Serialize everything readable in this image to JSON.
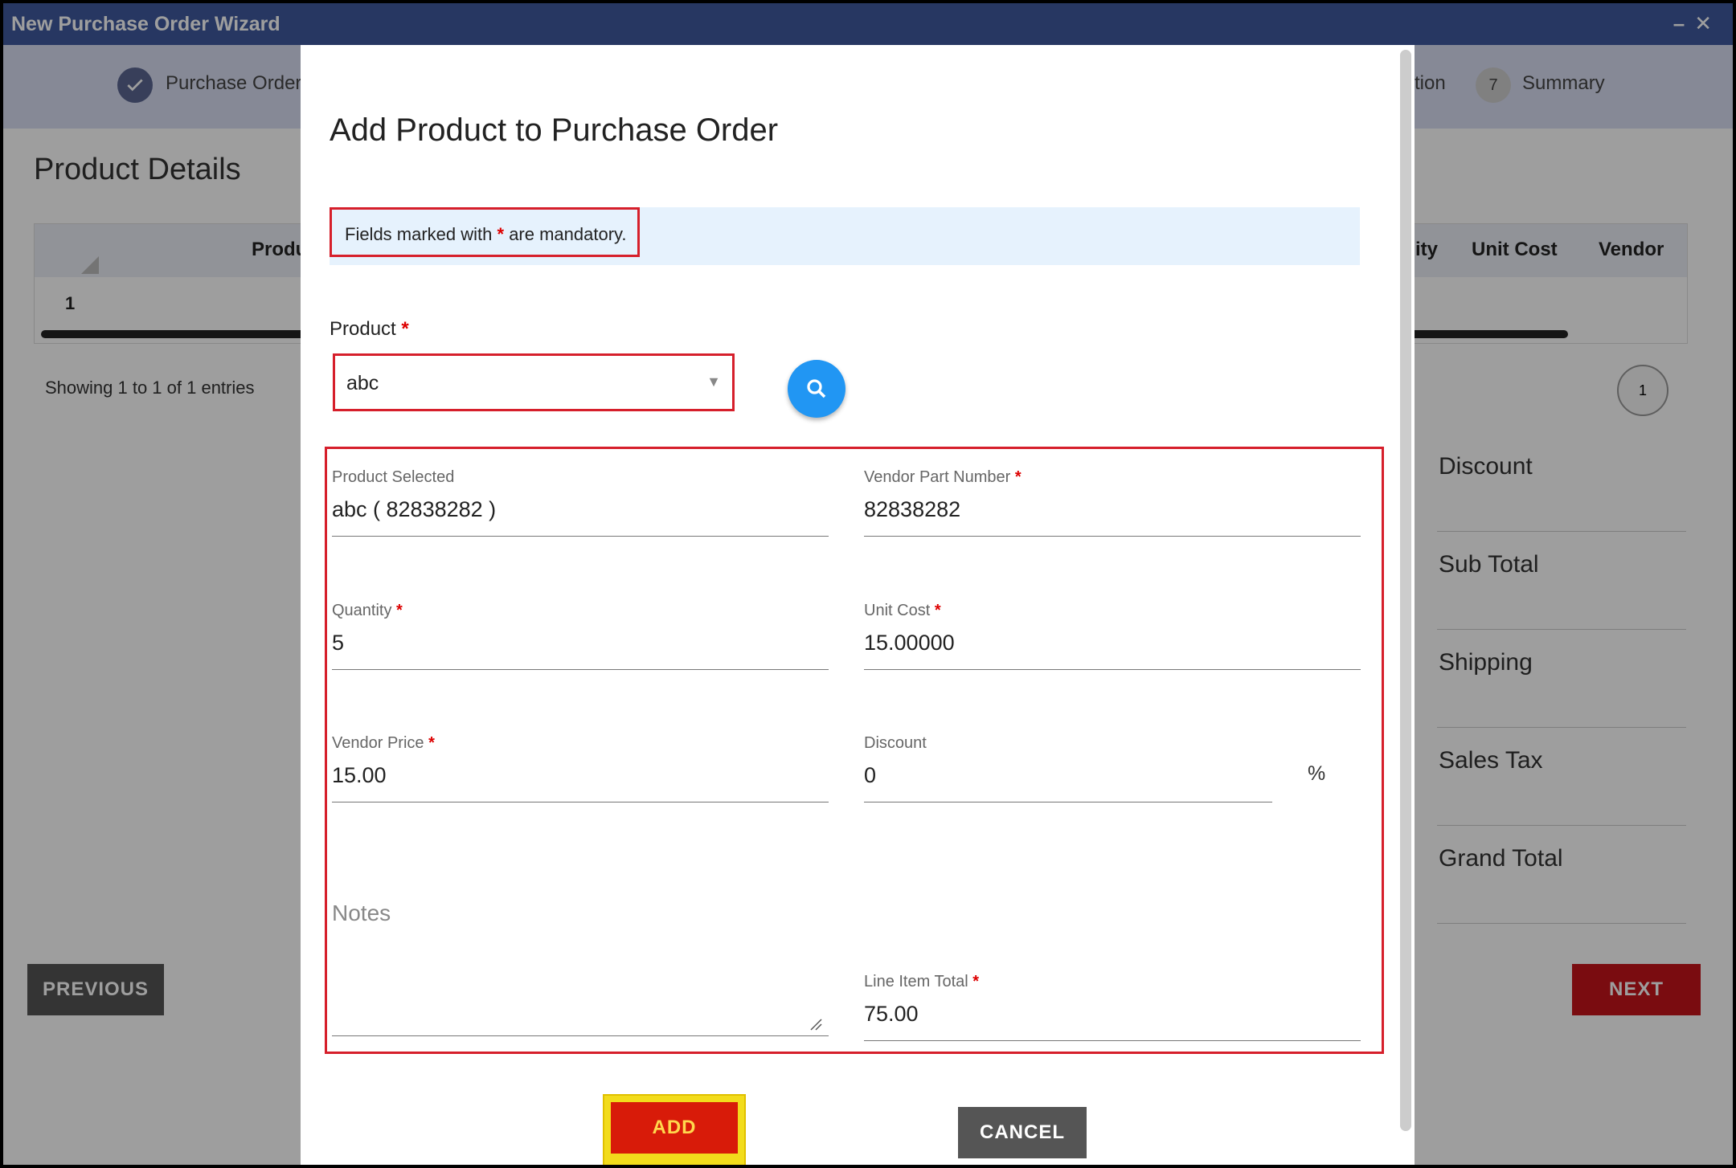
{
  "window": {
    "title": "New Purchase Order Wizard"
  },
  "stepper": {
    "steps": [
      {
        "label": "Purchase Order I",
        "state": "done"
      },
      {
        "label": "tion",
        "state": "partial"
      },
      {
        "number": "7",
        "label": "Summary"
      }
    ]
  },
  "background": {
    "section_title": "Product Details",
    "table_headers": {
      "product": "Produ",
      "quantity": "ity",
      "unit_cost": "Unit Cost",
      "vendor": "Vendor"
    },
    "row_number": "1",
    "showing": "Showing 1 to 1 of 1 entries",
    "page": "1",
    "totals": [
      "Discount",
      "Sub Total",
      "Shipping",
      "Sales Tax",
      "Grand Total"
    ],
    "previous": "PREVIOUS",
    "next": "NEXT"
  },
  "modal": {
    "title": "Add Product to Purchase Order",
    "mandatory_prefix": "Fields marked with ",
    "mandatory_star": "*",
    "mandatory_suffix": " are mandatory.",
    "product_label": "Product",
    "product_value": "abc",
    "fields": {
      "product_selected": {
        "label": "Product Selected",
        "value": "abc ( 82838282 )"
      },
      "vendor_part_number": {
        "label": "Vendor Part Number",
        "value": "82838282"
      },
      "quantity": {
        "label": "Quantity",
        "value": "5"
      },
      "unit_cost": {
        "label": "Unit Cost",
        "value": "15.00000"
      },
      "vendor_price": {
        "label": "Vendor Price",
        "value": "15.00"
      },
      "discount": {
        "label": "Discount",
        "value": "0",
        "unit": "%"
      },
      "notes": {
        "label": "Notes"
      },
      "line_item_total": {
        "label": "Line Item Total",
        "value": "75.00"
      }
    },
    "add": "ADD",
    "cancel": "CANCEL"
  },
  "colors": {
    "accent_red": "#d81b09",
    "fab_blue": "#2196f3",
    "highlight": "#f2dc1c"
  }
}
